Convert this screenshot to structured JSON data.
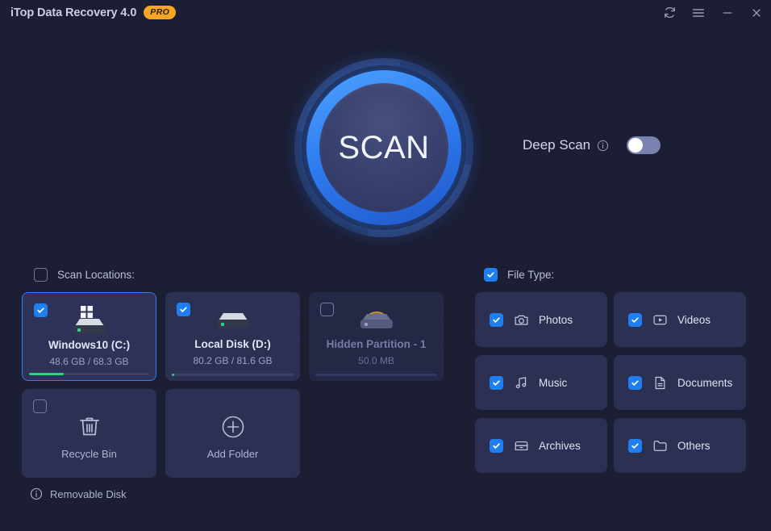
{
  "window": {
    "title": "iTop Data Recovery 4.0",
    "pro_badge": "PRO",
    "controls": [
      {
        "name": "refresh-button",
        "icon": "refresh-icon"
      },
      {
        "name": "menu-button",
        "icon": "hamburger-menu-icon"
      },
      {
        "name": "minimize-button",
        "icon": "minimize-icon"
      },
      {
        "name": "close-button",
        "icon": "close-icon"
      }
    ]
  },
  "scan": {
    "button_label": "SCAN",
    "deep_scan_label": "Deep Scan",
    "deep_scan_info_icon": "info-icon",
    "deep_scan_enabled": false
  },
  "locations": {
    "header_label": "Scan Locations:",
    "header_checked": false,
    "cards": [
      {
        "name": "Windows10 (C:)",
        "size": "48.6 GB / 68.3 GB",
        "checked": true,
        "selected": true,
        "disabled": false,
        "icon": "windows-drive-icon",
        "used_percent": 29
      },
      {
        "name": "Local Disk (D:)",
        "size": "80.2 GB / 81.6 GB",
        "checked": true,
        "selected": false,
        "disabled": false,
        "icon": "drive-icon",
        "used_percent": 2
      },
      {
        "name": "Hidden Partition - 1",
        "size": "50.0 MB",
        "checked": false,
        "selected": false,
        "disabled": true,
        "icon": "hidden-partition-icon",
        "used_percent": 0
      }
    ],
    "recycle_bin": {
      "label": "Recycle Bin",
      "checked": false,
      "icon": "trash-icon"
    },
    "add_folder": {
      "label": "Add Folder",
      "icon": "plus-circle-icon"
    },
    "removable_disk": {
      "label": "Removable Disk",
      "icon": "info-icon"
    }
  },
  "file_types": {
    "header_label": "File Type:",
    "header_checked": true,
    "items": [
      {
        "label": "Photos",
        "checked": true,
        "icon": "camera-icon"
      },
      {
        "label": "Videos",
        "checked": true,
        "icon": "video-icon"
      },
      {
        "label": "Music",
        "checked": true,
        "icon": "music-note-icon"
      },
      {
        "label": "Documents",
        "checked": true,
        "icon": "document-icon"
      },
      {
        "label": "Archives",
        "checked": true,
        "icon": "archive-icon"
      },
      {
        "label": "Others",
        "checked": true,
        "icon": "folder-icon"
      }
    ]
  },
  "colors": {
    "background": "#1c1e33",
    "card": "#2c3053",
    "accent_blue": "#2f7ef0",
    "accent_green": "#2fd18a",
    "pro_gold": "#f5a623",
    "text_primary": "#e2e5f4",
    "text_muted": "#9ba1c6"
  }
}
